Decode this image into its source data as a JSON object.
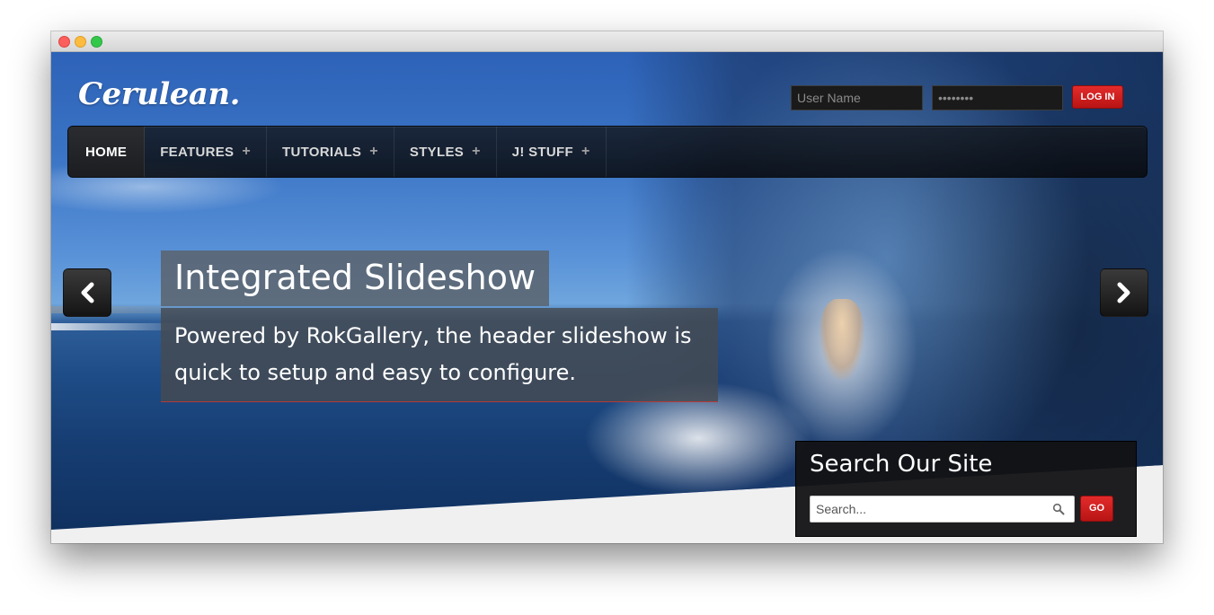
{
  "site": {
    "logo": "Cerulean."
  },
  "login": {
    "username_placeholder": "User Name",
    "password_value": "••••••••",
    "button_label": "LOG IN"
  },
  "nav": {
    "items": [
      {
        "label": "HOME",
        "active": true
      },
      {
        "label": "FEATURES",
        "has_submenu": true
      },
      {
        "label": "TUTORIALS",
        "has_submenu": true
      },
      {
        "label": "STYLES",
        "has_submenu": true
      },
      {
        "label": "J! STUFF",
        "has_submenu": true
      }
    ],
    "submenu_glyph": "+"
  },
  "slideshow": {
    "title": "Integrated Slideshow",
    "description": "Powered by RokGallery, the header slideshow is quick to setup and easy to configure.",
    "prev_icon": "chevron-left-icon",
    "next_icon": "chevron-right-icon"
  },
  "search": {
    "title": "Search Our Site",
    "placeholder": "Search...",
    "button_label": "GO"
  },
  "colors": {
    "accent_red": "#c91b1b",
    "nav_bg": "#14181e"
  }
}
